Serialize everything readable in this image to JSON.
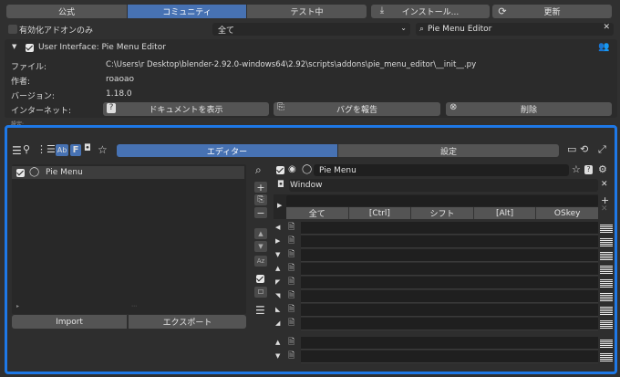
{
  "tabs": [
    "公式",
    "コミュニティ",
    "テスト中"
  ],
  "install_label": "インストール...",
  "refresh_label": "更新",
  "enabled_only_label": "有効化アドオンのみ",
  "category_value": "全て",
  "search_value": "Pie Menu Editor",
  "addon": {
    "title": "User Interface: Pie Menu Editor",
    "file_label": "ファイル:",
    "file_value": "C:\\Users\\r         Desktop\\blender-2.92.0-windows64\\2.92\\scripts\\addons\\pie_menu_editor\\__init__.py",
    "author_label": "作者:",
    "author_value": "roaoao",
    "version_label": "バージョン:",
    "version_value": "1.18.0",
    "internet_label": "インターネット:",
    "docs_label": "ドキュメントを表示",
    "bug_label": "バグを報告",
    "remove_label": "削除"
  },
  "prefs": {
    "settings_partial": "設定:",
    "editor_tab": "エディター",
    "settings_tab": "設定",
    "list_item": "Pie Menu",
    "import_label": "Import",
    "export_label": "エクスポート",
    "menu_name": "Pie Menu",
    "context": "Window",
    "hotkey_cols": [
      "全て",
      "[Ctrl]",
      "シフト",
      "[Alt]",
      "OSkey"
    ]
  },
  "colors": {
    "accent": "#4772b3",
    "highlight": "#1e78e6"
  }
}
